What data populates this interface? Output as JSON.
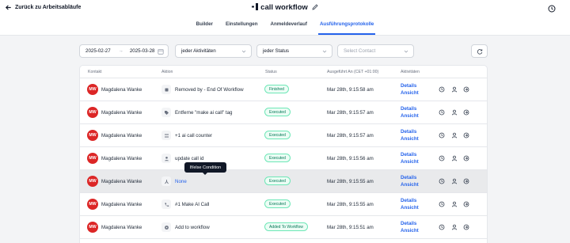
{
  "header": {
    "back_label": "Zurück zu Arbeitsabläufe",
    "workflow_title": "call workflow"
  },
  "tabs": [
    {
      "label": "Builder"
    },
    {
      "label": "Einstellungen"
    },
    {
      "label": "Anmeldeverlauf"
    },
    {
      "label": "Ausführungsprotokolle",
      "active": true
    }
  ],
  "filters": {
    "date_from": "2025-02-27",
    "date_to": "2025-03-28",
    "activity_select": "jeder Aktivitäten",
    "status_select": "jeder Status",
    "contact_placeholder": "Select Contact"
  },
  "table": {
    "columns": [
      "Kontakt",
      "Aktion",
      "Status",
      "Ausgeführt An (CET +01:00)",
      "Aktivitäten"
    ],
    "details_line1": "Details",
    "details_line2": "Ansicht",
    "rows": [
      {
        "initials": "MW",
        "contact": "Magdalena Wanke",
        "action": "Removed by - End Of Workflow",
        "action_icon": "stop-icon",
        "status": "Finished",
        "time": "Mar 28th, 9:15:58 am"
      },
      {
        "initials": "MW",
        "contact": "Magdalena Wanke",
        "action": "Entferne \"make ai call\" tag",
        "action_icon": "tag-icon",
        "status": "Executed",
        "time": "Mar 28th, 9:15:57 am"
      },
      {
        "initials": "MW",
        "contact": "Magdalena Wanke",
        "action": "+1 ai call counter",
        "action_icon": "counter-icon",
        "status": "Executed",
        "time": "Mar 28th, 9:15:57 am"
      },
      {
        "initials": "MW",
        "contact": "Magdalena Wanke",
        "action": "update call id",
        "action_icon": "user-icon",
        "status": "Executed",
        "time": "Mar 28th, 9:15:56 am"
      },
      {
        "initials": "MW",
        "contact": "Magdalena Wanke",
        "action": "None",
        "action_icon": "branch-icon",
        "status": "Executed",
        "time": "Mar 28th, 9:15:55 am",
        "link": true
      },
      {
        "initials": "MW",
        "contact": "Magdalena Wanke",
        "action": "#1 Make AI Call",
        "action_icon": "phone-icon",
        "status": "Executed",
        "time": "Mar 28th, 9:15:55 am"
      },
      {
        "initials": "MW",
        "contact": "Magdalena Wanke",
        "action": "Add to workflow",
        "action_icon": "gear-icon",
        "status": "Added To Workflow",
        "time": "Mar 28th, 9:15:51 am"
      }
    ]
  },
  "tooltip": "If/else Condition",
  "colors": {
    "accent": "#2563eb",
    "avatar": "#dc2626",
    "status_green": "#047857"
  }
}
